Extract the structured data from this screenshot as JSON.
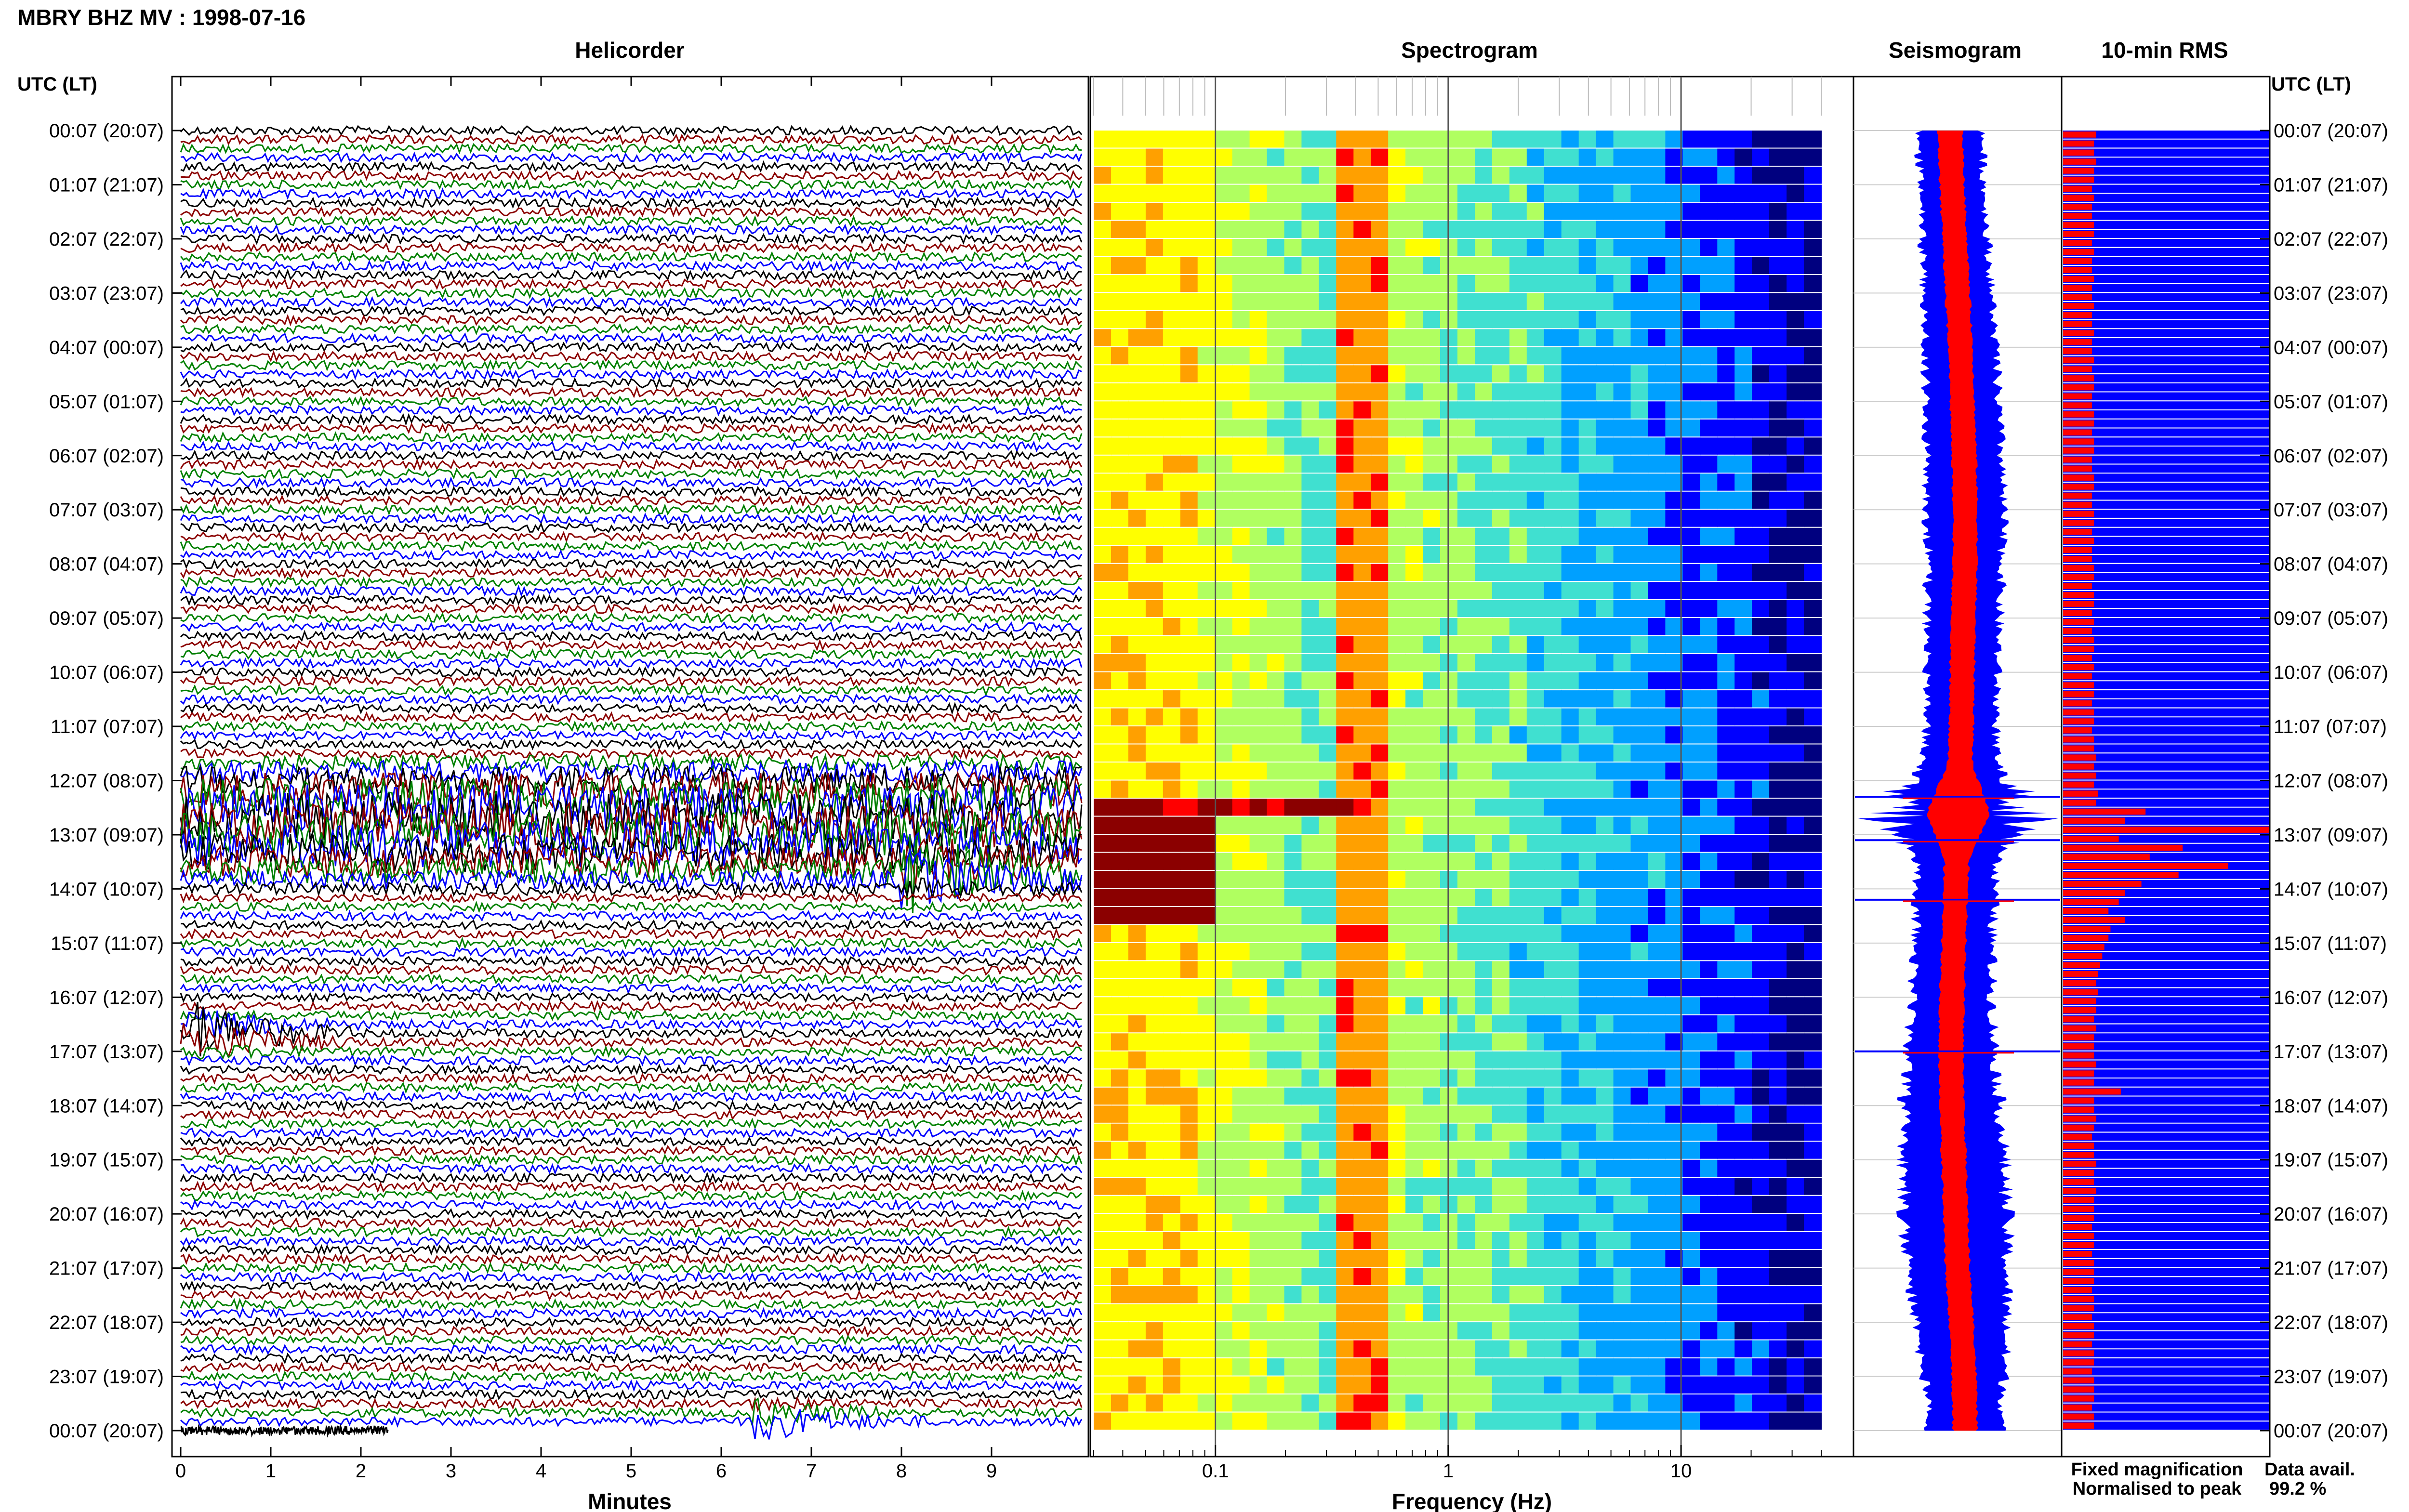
{
  "header": {
    "title": "MBRY BHZ MV : 1998-07-16"
  },
  "panels": {
    "helicorder": "Helicorder",
    "spectrogram": "Spectrogram",
    "seismogram": "Seismogram",
    "rms": "10-min RMS"
  },
  "axes": {
    "left_header": "UTC (LT)",
    "right_header": "UTC (LT)",
    "minutes_label": "Minutes",
    "frequency_label": "Frequency (Hz)"
  },
  "legend": {
    "fixed": "Fixed magnification",
    "normalised": "Normalised to peak",
    "fixed_color": "#0000ff",
    "normalised_color": "#ff0000"
  },
  "data_avail": {
    "label": "Data avail.",
    "value": "99.2 %"
  },
  "chart_data": {
    "type": "multi-panel seismic summary",
    "time_labels": [
      "00:07 (20:07)",
      "01:07 (21:07)",
      "02:07 (22:07)",
      "03:07 (23:07)",
      "04:07 (00:07)",
      "05:07 (01:07)",
      "06:07 (02:07)",
      "07:07 (03:07)",
      "08:07 (04:07)",
      "09:07 (05:07)",
      "10:07 (06:07)",
      "11:07 (07:07)",
      "12:07 (08:07)",
      "13:07 (09:07)",
      "14:07 (10:07)",
      "15:07 (11:07)",
      "16:07 (12:07)",
      "17:07 (13:07)",
      "18:07 (14:07)",
      "19:07 (15:07)",
      "20:07 (16:07)",
      "21:07 (17:07)",
      "22:07 (18:07)",
      "23:07 (19:07)",
      "00:07 (20:07)"
    ],
    "helicorder": {
      "x_ticks": [
        "0",
        "1",
        "2",
        "3",
        "4",
        "5",
        "6",
        "7",
        "8",
        "9"
      ],
      "xlim": [
        0,
        10
      ],
      "trace_colors": [
        "#000000",
        "#8b0000",
        "#008000",
        "#0000ff"
      ],
      "rows_per_hour": 6,
      "events": [
        {
          "hour": 12.4,
          "minute_start": 0,
          "minute_end": 10,
          "amplitude": "high",
          "note": "tremor swarm"
        },
        {
          "hour": 13.2,
          "minute_start": 0,
          "minute_end": 10,
          "amplitude": "high"
        },
        {
          "hour": 13.7,
          "minute": 8.2,
          "amplitude": "high"
        },
        {
          "hour": 16.7,
          "minute": 0.2,
          "amplitude": "high"
        },
        {
          "hour": 23.8,
          "minute": 6.5,
          "amplitude": "medium"
        }
      ]
    },
    "spectrogram": {
      "x_scale": "log",
      "x_ticks": [
        "0.1",
        "1",
        "10"
      ],
      "xlim": [
        0.03,
        40
      ],
      "peak_band_hz": [
        0.35,
        0.6
      ],
      "colormap": [
        "#00007f",
        "#0000ff",
        "#00a0ff",
        "#40e0d0",
        "#b0ff60",
        "#ffff00",
        "#ffa000",
        "#ff0000",
        "#8b0000"
      ]
    },
    "seismogram": {
      "fixed_magnification_halfwidth": [
        0.62,
        0.62,
        0.64,
        0.66,
        0.68,
        0.7,
        0.72,
        0.74,
        0.72,
        0.7,
        0.68,
        0.68,
        0.7,
        0.74,
        0.76,
        0.74,
        0.78,
        0.85,
        0.93,
        0.98,
        1.0,
        0.96,
        0.88,
        0.78,
        0.7
      ],
      "center_drift": [
        -0.08,
        -0.06,
        -0.03,
        0.0,
        0.03,
        0.05,
        0.07,
        0.08,
        0.08,
        0.06,
        0.05,
        0.04,
        0.02,
        0.0,
        -0.02,
        -0.04,
        -0.06,
        -0.07,
        -0.06,
        -0.04,
        -0.02,
        0.0,
        0.04,
        0.07,
        0.08
      ],
      "spike_hours": [
        12.3,
        13.1,
        14.2,
        17.0
      ]
    },
    "rms_10min": {
      "units": "relative",
      "xlim": [
        0,
        1
      ],
      "values": [
        0.16,
        0.15,
        0.15,
        0.16,
        0.15,
        0.15,
        0.14,
        0.15,
        0.14,
        0.14,
        0.15,
        0.15,
        0.14,
        0.15,
        0.14,
        0.14,
        0.15,
        0.14,
        0.14,
        0.15,
        0.14,
        0.14,
        0.15,
        0.14,
        0.14,
        0.15,
        0.14,
        0.15,
        0.15,
        0.14,
        0.14,
        0.15,
        0.15,
        0.14,
        0.15,
        0.15,
        0.14,
        0.14,
        0.15,
        0.15,
        0.14,
        0.14,
        0.15,
        0.15,
        0.14,
        0.15,
        0.14,
        0.14,
        0.15,
        0.15,
        0.14,
        0.15,
        0.15,
        0.14,
        0.15,
        0.14,
        0.15,
        0.15,
        0.14,
        0.15,
        0.14,
        0.15,
        0.15,
        0.14,
        0.15,
        0.15,
        0.14,
        0.15,
        0.15,
        0.16,
        0.15,
        0.16,
        0.15,
        0.17,
        0.16,
        0.4,
        0.3,
        1.0,
        0.27,
        0.58,
        0.42,
        0.8,
        0.56,
        0.38,
        0.3,
        0.27,
        0.22,
        0.3,
        0.23,
        0.22,
        0.2,
        0.19,
        0.18,
        0.17,
        0.16,
        0.17,
        0.16,
        0.16,
        0.15,
        0.16,
        0.15,
        0.15,
        0.15,
        0.16,
        0.15,
        0.15,
        0.28,
        0.15,
        0.15,
        0.16,
        0.15,
        0.14,
        0.15,
        0.15,
        0.16,
        0.15,
        0.15,
        0.16,
        0.15,
        0.15,
        0.15,
        0.14,
        0.15,
        0.15,
        0.14,
        0.15,
        0.15,
        0.15,
        0.14,
        0.15,
        0.15,
        0.14,
        0.15,
        0.15,
        0.14,
        0.15,
        0.15,
        0.14,
        0.15,
        0.15,
        0.15,
        0.14,
        0.15,
        0.15
      ]
    }
  }
}
